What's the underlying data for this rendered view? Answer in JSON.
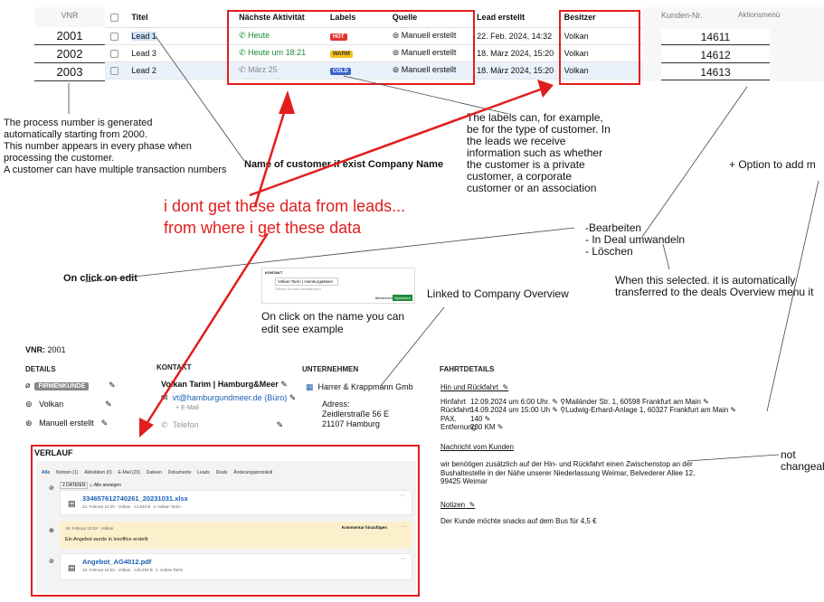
{
  "lead_table": {
    "vnr_header": "VNR",
    "vnr": [
      "2001",
      "2002",
      "2003"
    ],
    "headers": [
      "Titel",
      "Nächste Aktivität",
      "Labels",
      "Quelle",
      "Lead erstellt",
      "Besitzer"
    ],
    "rows": [
      {
        "title": "Lead 1",
        "activity": "Heute",
        "label": "HOT",
        "source": "Manuell erstellt",
        "created": "22. Feb. 2024, 14:32",
        "owner": "Volkan"
      },
      {
        "title": "Lead 3",
        "activity": "Heute um 18:21",
        "label": "WARM",
        "source": "Manuell erstellt",
        "created": "18. März 2024, 15:20",
        "owner": "Volkan"
      },
      {
        "title": "Lead 2",
        "activity": "März 25",
        "label": "COLD",
        "source": "Manuell erstellt",
        "created": "18. März 2024, 15:20",
        "owner": "Volkan"
      }
    ],
    "kunden_header": "Kunden-Nr.",
    "aktions_header": "Aktionsmenü",
    "kunden": [
      "14611",
      "14612",
      "14613"
    ]
  },
  "notes": {
    "process_number": [
      "The process number is generated",
      "automatically starting from 2000.",
      "This number appears in every phase when",
      "processing the customer.",
      "A customer can have multiple transaction numbers"
    ],
    "name_of_customer": "Name of customer if exist Company Name",
    "labels_note": [
      "The labels can, for example,",
      "be for the type of customer. In",
      "the leads we receive",
      "information such as whether",
      "the customer is a private",
      "customer, a corporate",
      "customer or an association"
    ],
    "add_more": "+ Option to add m",
    "red_question_1": "i dont get these data from leads...",
    "red_question_2": "from where i get these data",
    "menu_items": [
      "-Bearbeiten",
      "- In Deal umwandeln",
      "- Löschen"
    ],
    "on_click_edit": "On click on edit",
    "transfer_1": "When this selected. it is automatically",
    "transfer_2": "transferred to the deals  Overview menu it",
    "linked": "Linked to Company Overview",
    "click_name_1": "On click on the name you can",
    "click_name_2": "edit see example",
    "not_changeable": "not changeabl"
  },
  "mini_popup": {
    "title": "KONTAKT",
    "value": "Volkan Tarim | Hamburg&Meer",
    "hint": "Diesen Kontakt aktualisieren",
    "cancel": "Abbrechen",
    "save": "Speichern"
  },
  "detail": {
    "vnr_label": "VNR:",
    "vnr_value": "2001",
    "details_title": "DETAILS",
    "firmenkunde": "FIRMENKUNDE",
    "owner": "Volkan",
    "source": "Manuell erstellt",
    "kontakt_title": "KONTAKT",
    "contact_name": "Volkan Tarim | Hamburg&Meer",
    "email": "vt@hamburgundmeer.de (Büro)",
    "email_hint": "+ E-Mail",
    "phone": "Telefon",
    "company_title": "UNTERNEHMEN",
    "company": "Harrer & Krappmann Gmb",
    "address_label": "Adress:",
    "address_1": "Zeidlerstraße 56 E",
    "address_2": "21107 Hamburg",
    "fahrt_title": "FAHRTDETAILS",
    "hin_rueck": "Hin und Rückfahrt",
    "hinfahrt_label": "Hinfahrt",
    "hinfahrt": "12.09.2024 um 6:00 Uhr.",
    "hinfahrt_loc": "Mailänder Str. 1, 60598 Frankfurt am Main",
    "rueckfahrt_label": "Rückfahrt",
    "rueckfahrt": "14.09.2024 um 15:00 Uh",
    "rueckfahrt_loc": "Ludwig-Erhard-Anlage 1, 60327 Frankfurt am Main",
    "pax_label": "PAX.",
    "pax": "140",
    "entfernung_label": "Entfernung",
    "entfernung": "230 KM",
    "nachricht_title": "Nachricht vom Kunden",
    "nachricht_1": "wir benötigen zusätzlich auf der Hin- und Rückfahrt einen Zwischenstop an der",
    "nachricht_2": "Bushaltestelle in der Nähe unserer Niederlassung Weimar, Belvederer Allee 12,",
    "nachricht_3": "99425 Weimar",
    "notizen_title": "Notizen",
    "notiz": "Der Kunde möchte snacks auf dem Bus für 4,5 €"
  },
  "verlauf": {
    "title": "VERLAUF",
    "tabs": [
      "Alle",
      "Notizen (1)",
      "Aktivitäten (0)",
      "E-Mail (23)",
      "Dateien",
      "Dokumente",
      "Leads",
      "Deals",
      "Änderungsprotokoll"
    ],
    "files_chip": "2 DATEIEN",
    "show_all": "Alle anzeigen",
    "file1_name": "334657612740261_20231031.xlsx",
    "file1_meta": "22. Februar 14:20 · Volkan · 12.643 B",
    "file1_owner": "Volkan Tarim",
    "note_meta": "19. Februar 15:03 · Volkan",
    "note_action": "Kommentar hinzufügen",
    "note_text": "Ein Angebot wurde in lexoffice erstellt",
    "file2_name": "Angebot_AG4012.pdf",
    "file2_meta": "19. Februar 15:03 · Volkan · 125.555 B",
    "file2_owner": "Volkan Tarim"
  }
}
